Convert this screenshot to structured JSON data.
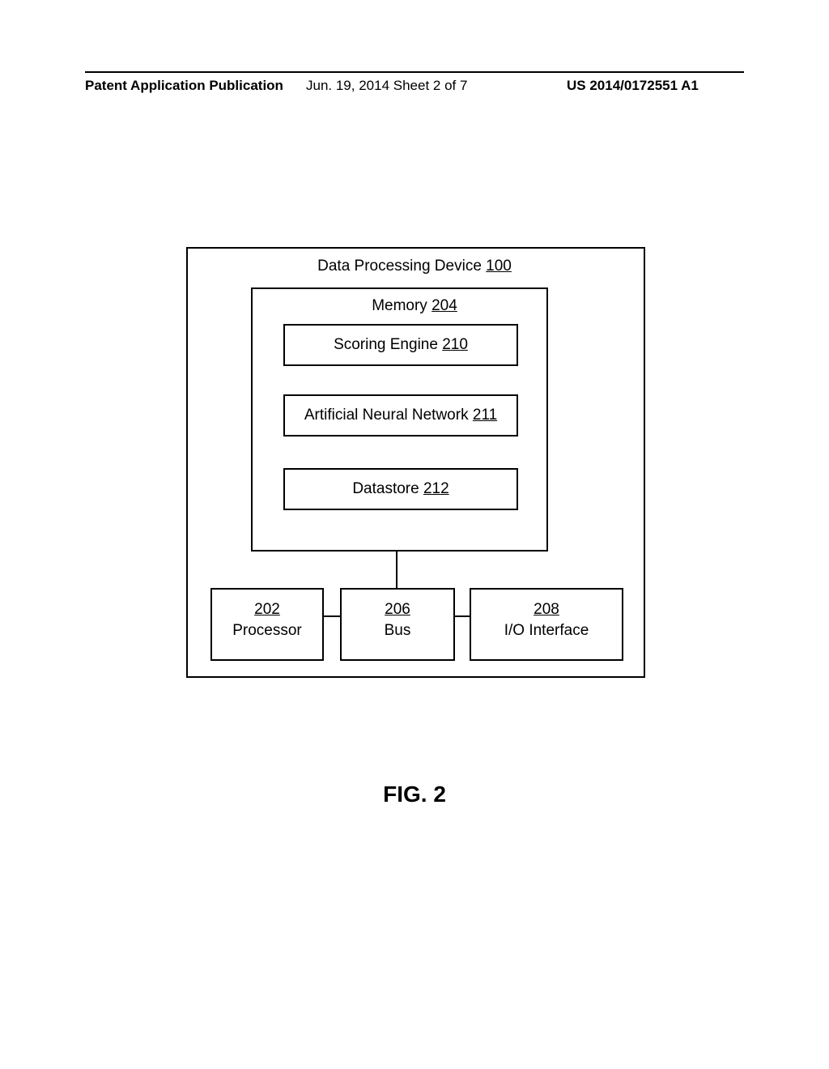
{
  "header": {
    "left": "Patent Application Publication",
    "center": "Jun. 19, 2014  Sheet 2 of 7",
    "right": "US 2014/0172551 A1"
  },
  "device": {
    "label": "Data Processing Device ",
    "ref": "100"
  },
  "memory": {
    "label": "Memory ",
    "ref": "204"
  },
  "scoring": {
    "label": "Scoring Engine ",
    "ref": "210"
  },
  "ann": {
    "label": "Artificial Neural Network ",
    "ref": "211"
  },
  "datastore": {
    "label": "Datastore ",
    "ref": "212"
  },
  "processor": {
    "ref": "202",
    "label": "Processor"
  },
  "bus": {
    "ref": "206",
    "label": "Bus"
  },
  "io": {
    "ref": "208",
    "label": "I/O Interface"
  },
  "figure": "FIG. 2"
}
